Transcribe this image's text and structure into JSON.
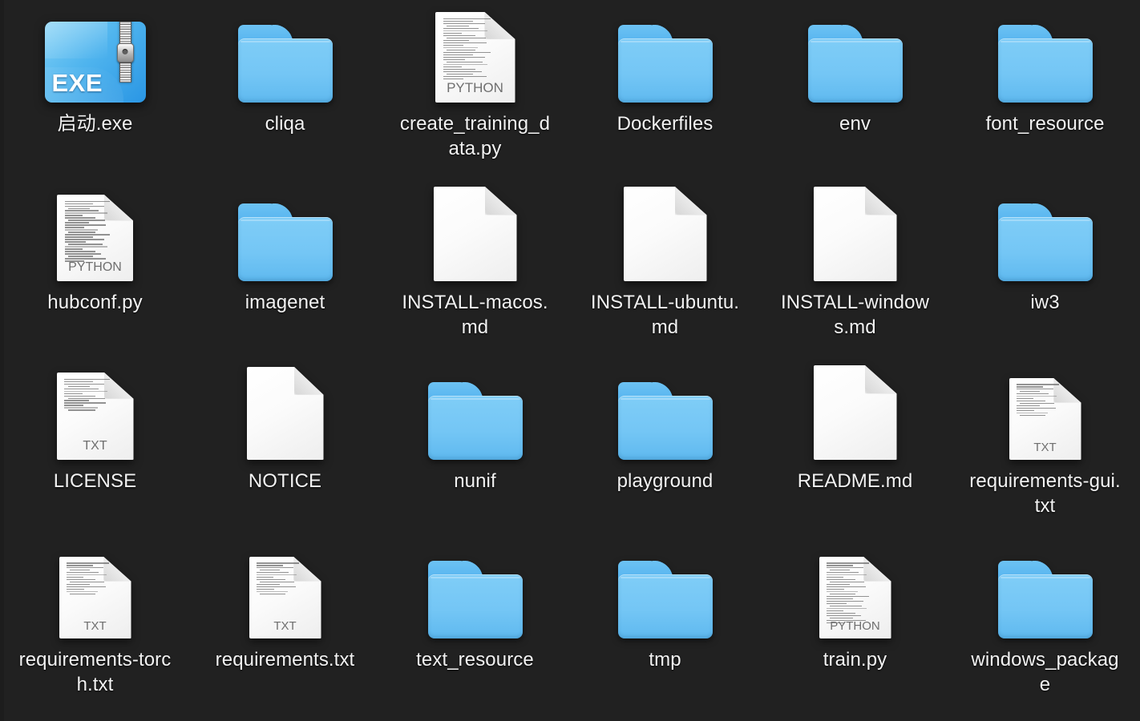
{
  "desktop": {
    "background_color": "#212121",
    "label_color": "#f2f2f2",
    "folder_color": "#74c6f5",
    "accent_color": "#4fb4ee"
  },
  "icon_kinds": {
    "python_badge": "PYTHON",
    "txt_badge": "TXT",
    "exe_badge": "EXE"
  },
  "items": [
    {
      "name": "启动.exe",
      "icon": "exe-file-icon",
      "kind": "exe",
      "badge": "EXE"
    },
    {
      "name": "cliqa",
      "icon": "folder-icon",
      "kind": "folder",
      "badge": ""
    },
    {
      "name": "create_training_data.py",
      "icon": "python-file-icon",
      "kind": "python",
      "badge": "PYTHON"
    },
    {
      "name": "Dockerfiles",
      "icon": "folder-icon",
      "kind": "folder",
      "badge": ""
    },
    {
      "name": "env",
      "icon": "folder-icon",
      "kind": "folder",
      "badge": ""
    },
    {
      "name": "font_resource",
      "icon": "folder-icon",
      "kind": "folder",
      "badge": ""
    },
    {
      "name": "hubconf.py",
      "icon": "python-file-icon",
      "kind": "python",
      "badge": "PYTHON"
    },
    {
      "name": "imagenet",
      "icon": "folder-icon",
      "kind": "folder",
      "badge": ""
    },
    {
      "name": "INSTALL-macos.md",
      "icon": "document-icon",
      "kind": "blank",
      "badge": ""
    },
    {
      "name": "INSTALL-ubuntu.md",
      "icon": "document-icon",
      "kind": "blank",
      "badge": ""
    },
    {
      "name": "INSTALL-windows.md",
      "icon": "document-icon",
      "kind": "blank",
      "badge": ""
    },
    {
      "name": "iw3",
      "icon": "folder-icon",
      "kind": "folder",
      "badge": ""
    },
    {
      "name": "LICENSE",
      "icon": "text-file-icon",
      "kind": "txt",
      "badge": "TXT"
    },
    {
      "name": "NOTICE",
      "icon": "document-icon",
      "kind": "blank",
      "badge": ""
    },
    {
      "name": "nunif",
      "icon": "folder-icon",
      "kind": "folder",
      "badge": ""
    },
    {
      "name": "playground",
      "icon": "folder-icon",
      "kind": "folder",
      "badge": ""
    },
    {
      "name": "README.md",
      "icon": "document-icon",
      "kind": "blank",
      "badge": ""
    },
    {
      "name": "requirements-gui.txt",
      "icon": "text-file-icon",
      "kind": "txt",
      "badge": "TXT"
    },
    {
      "name": "requirements-torch.txt",
      "icon": "text-file-icon",
      "kind": "txt",
      "badge": "TXT"
    },
    {
      "name": "requirements.txt",
      "icon": "text-file-icon",
      "kind": "txt",
      "badge": "TXT"
    },
    {
      "name": "text_resource",
      "icon": "folder-icon",
      "kind": "folder",
      "badge": ""
    },
    {
      "name": "tmp",
      "icon": "folder-icon",
      "kind": "folder",
      "badge": ""
    },
    {
      "name": "train.py",
      "icon": "python-file-icon",
      "kind": "python",
      "badge": "PYTHON"
    },
    {
      "name": "windows_package",
      "icon": "folder-icon",
      "kind": "folder",
      "badge": ""
    }
  ]
}
